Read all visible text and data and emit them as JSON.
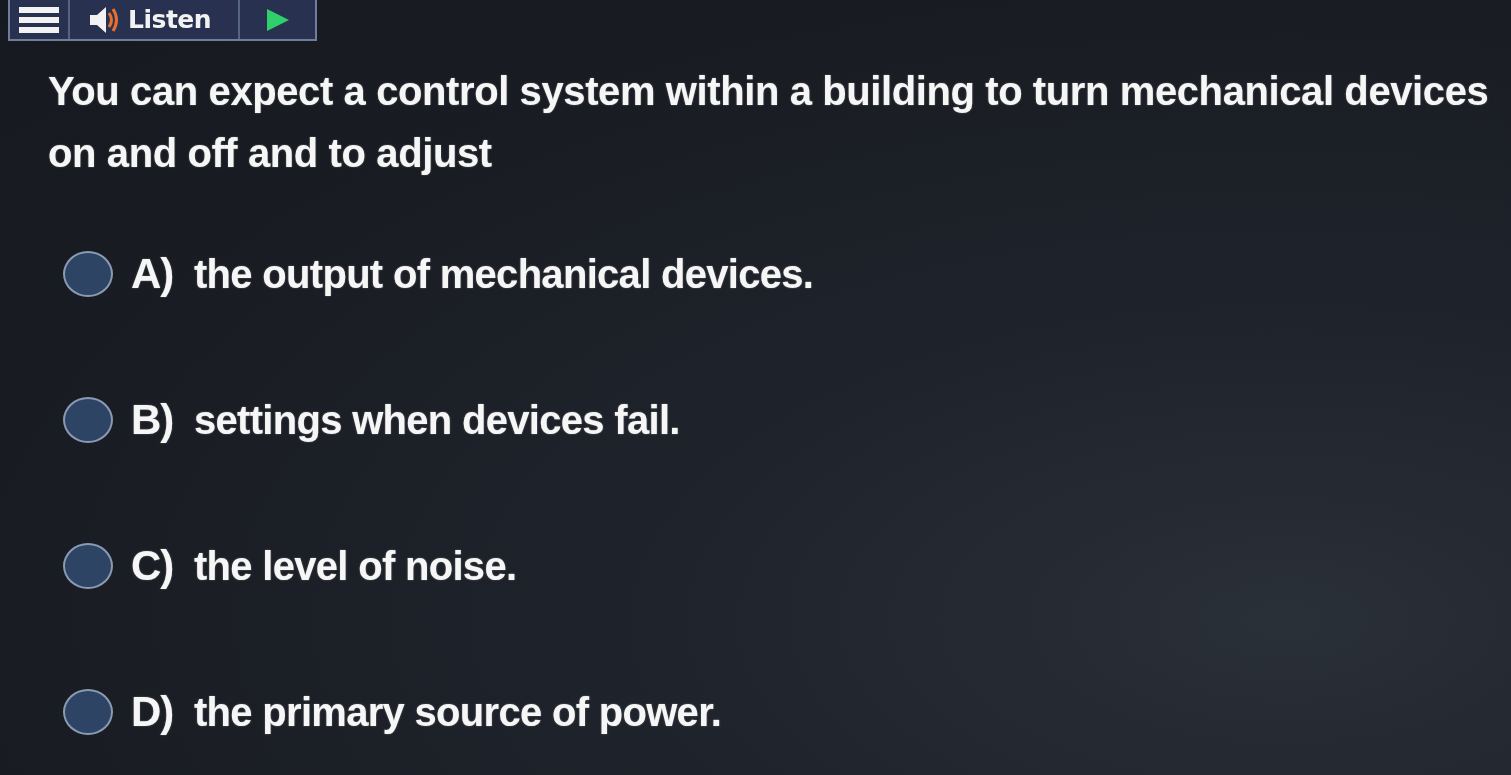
{
  "toolbar": {
    "listen_label": "Listen"
  },
  "question": {
    "text": "You can expect a control system within a building to turn mechanical devices on and off and to adjust"
  },
  "options": [
    {
      "letter": "A)",
      "text": "the output of mechanical devices.",
      "selected": false
    },
    {
      "letter": "B)",
      "text": "settings when devices fail.",
      "selected": false
    },
    {
      "letter": "C)",
      "text": "the level of noise.",
      "selected": false
    },
    {
      "letter": "D)",
      "text": "the primary source of power.",
      "selected": false
    }
  ]
}
